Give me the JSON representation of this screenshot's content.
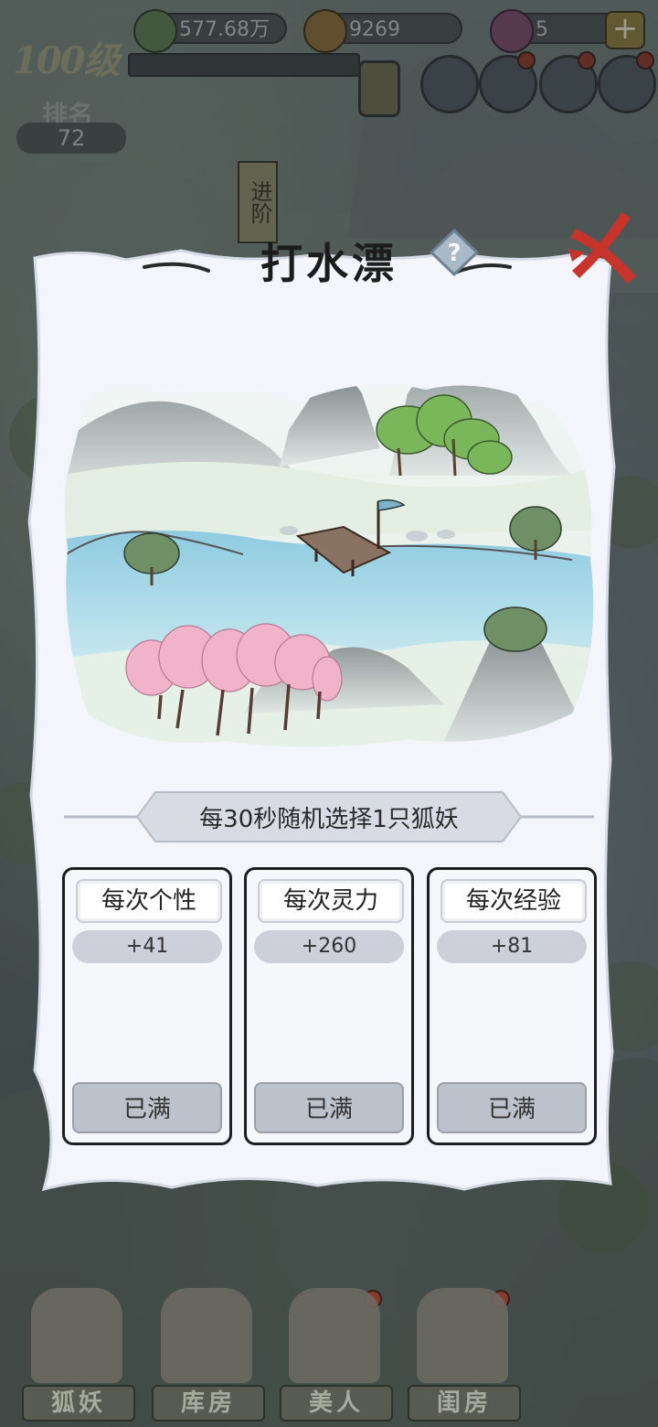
{
  "resources": {
    "silver": "577.68万",
    "copper": "9269",
    "gems": "5",
    "plus": "+"
  },
  "player": {
    "level": "100级",
    "rank_label": "排名",
    "rank_value": "72"
  },
  "side": {
    "advance_label": "进阶"
  },
  "modal": {
    "title": "打水漂",
    "help": "?",
    "info": "每30秒随机选择1只狐妖",
    "cards": [
      {
        "label": "每次个性",
        "value": "+41",
        "button": "已满"
      },
      {
        "label": "每次灵力",
        "value": "+260",
        "button": "已满"
      },
      {
        "label": "每次经验",
        "value": "+81",
        "button": "已满"
      }
    ]
  },
  "nav": {
    "items": [
      "狐妖",
      "库房",
      "美人",
      "闺房"
    ]
  },
  "colors": {
    "lake": "#a9d8e6",
    "cherry": "#f1b3c9",
    "tree_green": "#7ab65a",
    "close_red": "#c8332a"
  }
}
